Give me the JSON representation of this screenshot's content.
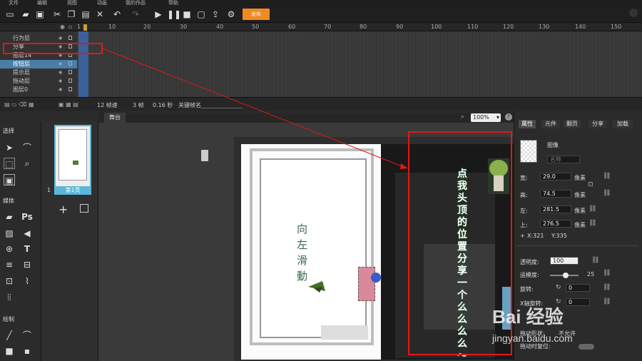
{
  "menu": [
    "文件",
    "编辑",
    "视图",
    "动画",
    "我的作品",
    "帮助"
  ],
  "toolbar": {
    "publish": "发布"
  },
  "ruler_ticks": [
    "1",
    "10",
    "20",
    "30",
    "40",
    "50",
    "60",
    "70",
    "80",
    "90",
    "100",
    "110",
    "120",
    "130",
    "140",
    "150"
  ],
  "layers": [
    "行为层",
    "分享",
    "图层14",
    "按钮层",
    "提示层",
    "拖动层",
    "图层0"
  ],
  "selected_layer": "按钮层",
  "timeline_status": {
    "fps": "12 帧速",
    "frames": "3 帧",
    "time": "0.16 秒",
    "keyframe_label": "关键帧名"
  },
  "tools": {
    "select_head": "选择",
    "media_head": "媒体",
    "draw_head": "绘制"
  },
  "pages": {
    "page_num": "1",
    "thumb_label": "第1页"
  },
  "stage": {
    "tab": "舞台",
    "zoom": "100%"
  },
  "page_text": {
    "poem": "向左滑動",
    "instruction": "点我头顶的位置分享一个么么么么～"
  },
  "props": {
    "tabs": [
      "属性",
      "元件",
      "翻页",
      "分享",
      "加载"
    ],
    "image_label": "图像",
    "name_placeholder": "名称",
    "width_label": "宽:",
    "width_value": "29.0",
    "width_unit": "像素",
    "height_label": "高:",
    "height_value": "74.5",
    "height_unit": "像素",
    "left_label": "左:",
    "left_value": "281.5",
    "left_unit": "像素",
    "top_label": "上:",
    "top_value": "276.5",
    "top_unit": "像素",
    "x_readout": "X:321",
    "y_readout": "Y:335",
    "opacity_label": "透明度:",
    "opacity_value": "100",
    "blur_label": "运模度:",
    "blur_value": "25",
    "rotate_label": "旋转:",
    "rotate_value": "0",
    "xaxis_label": "X轴旋转:",
    "xaxis_value": "0",
    "drag_label": "拖动形状:",
    "drag_value": "不允许",
    "reset_label": "拖动时复位:"
  },
  "watermark": {
    "brand": "Bai 经验",
    "url": "jingyan.baidu.com"
  },
  "colors": {
    "accent": "#f08a24",
    "selection": "#4a7ea8",
    "annotation": "#e01818"
  }
}
